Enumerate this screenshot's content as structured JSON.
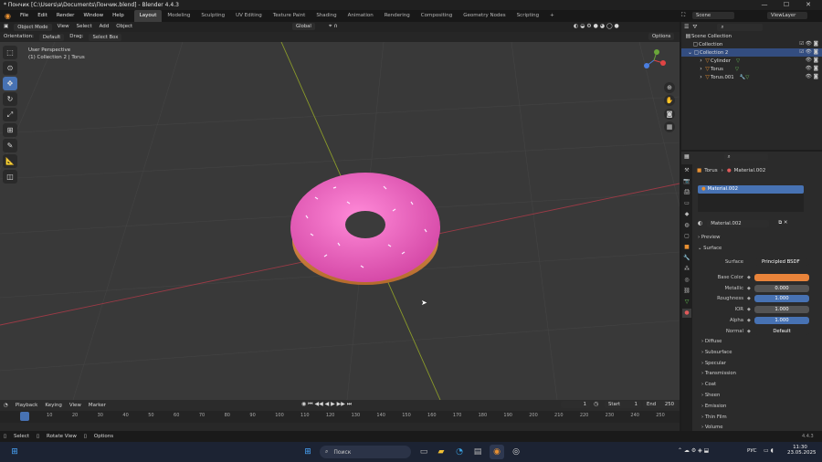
{
  "window": {
    "title": "* Пончик [C:\\Users\\a\\Documents\\Пончик.blend] - Blender 4.4.3",
    "minimize": "—",
    "maximize": "☐",
    "close": "✕"
  },
  "menus": [
    "File",
    "Edit",
    "Render",
    "Window",
    "Help"
  ],
  "workspaces": [
    "Layout",
    "Modeling",
    "Sculpting",
    "UV Editing",
    "Texture Paint",
    "Shading",
    "Animation",
    "Rendering",
    "Compositing",
    "Geometry Nodes",
    "Scripting",
    "+"
  ],
  "scene": {
    "label": "Scene",
    "view_layer": "ViewLayer"
  },
  "viewport_header": {
    "mode": "Object Mode",
    "menus": [
      "View",
      "Select",
      "Add",
      "Object"
    ],
    "transform": "Global",
    "options": "Options"
  },
  "tool_settings": {
    "orientation_label": "Orientation:",
    "orientation_value": "Default",
    "drag_label": "Drag:",
    "drag_value": "Select Box"
  },
  "viewport": {
    "perspective": "User Perspective",
    "context": "(1) Collection 2 | Torus"
  },
  "gizmo": {
    "x": "X",
    "y": "Y",
    "z": "Z"
  },
  "outliner": {
    "search_placeholder": "",
    "items": [
      {
        "label": "Scene Collection"
      },
      {
        "label": "Collection"
      },
      {
        "label": "Collection 2"
      },
      {
        "label": "Cylinder"
      },
      {
        "label": "Torus"
      },
      {
        "label": "Torus.001"
      }
    ]
  },
  "properties": {
    "breadcrumb_object": "Torus",
    "breadcrumb_material": "Material.002",
    "slot": "Material.002",
    "material_name": "Material.002",
    "preview": "Preview",
    "surface_section": "Surface",
    "surface_label": "Surface",
    "surface_value": "Principled BSDF",
    "fields": [
      {
        "label": "Base Color",
        "value": "",
        "color": "#e8833a"
      },
      {
        "label": "Metallic",
        "value": "0.000",
        "color": "#545454"
      },
      {
        "label": "Roughness",
        "value": "1.000",
        "color": "#4772b3"
      },
      {
        "label": "IOR",
        "value": "1.000",
        "color": "#545454"
      },
      {
        "label": "Alpha",
        "value": "1.000",
        "color": "#4772b3"
      },
      {
        "label": "Normal",
        "value": "Default",
        "color": "#2b2b2b"
      }
    ],
    "subsections": [
      "Diffuse",
      "Subsurface",
      "Specular",
      "Transmission",
      "Coat",
      "Sheen",
      "Emission",
      "Thin Film",
      "Volume"
    ]
  },
  "timeline": {
    "menus": [
      "Playback",
      "Keying",
      "View",
      "Marker"
    ],
    "current_frame": "1",
    "start_label": "Start",
    "start": "1",
    "end_label": "End",
    "end": "250",
    "ticks": [
      "1",
      "10",
      "20",
      "30",
      "40",
      "50",
      "60",
      "70",
      "80",
      "90",
      "100",
      "110",
      "120",
      "130",
      "140",
      "150",
      "160",
      "170",
      "180",
      "190",
      "200",
      "210",
      "220",
      "230",
      "240",
      "250"
    ]
  },
  "statusbar": {
    "select": "Select",
    "rotate": "Rotate View",
    "options": "Options",
    "version": "4.4.3"
  },
  "taskbar": {
    "search": "Поиск",
    "lang": "РУС",
    "time": "11:30",
    "date": "23.05.2025"
  }
}
